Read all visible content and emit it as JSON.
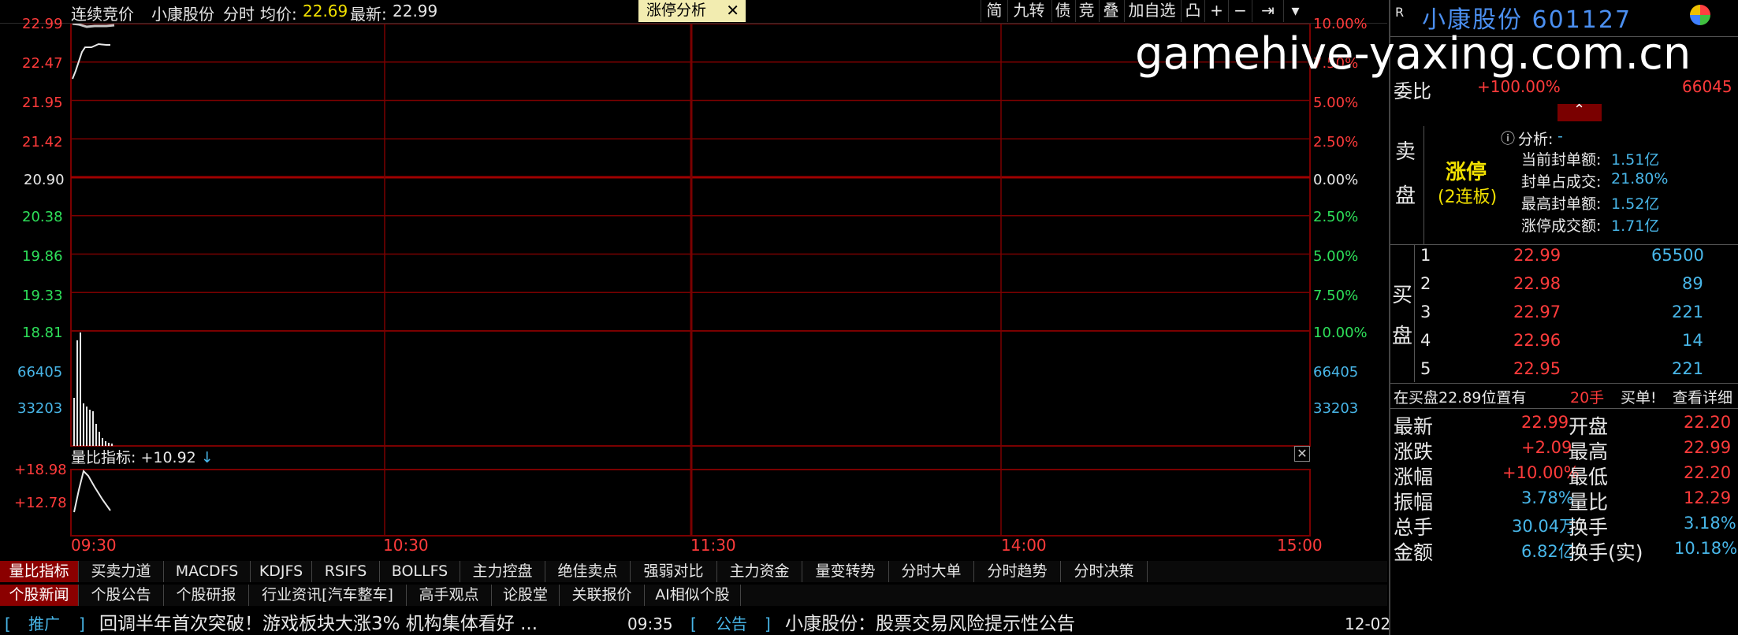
{
  "header": {
    "mode": "连续竞价",
    "stock_name": "小康股份",
    "view": "分时",
    "avg_label": "均价:",
    "avg_value": "22.69",
    "last_label": "最新:",
    "last_value": "22.99",
    "tab_label": "涨停分析",
    "tab_close": "✕",
    "toolbar": [
      "简",
      "九转",
      "债",
      "竞",
      "叠",
      "加自选",
      "凸",
      "+",
      "−",
      "⇥",
      "▾"
    ]
  },
  "price_axis_left": [
    "22.99",
    "22.47",
    "21.95",
    "21.42",
    "20.90",
    "20.38",
    "19.86",
    "19.33",
    "18.81"
  ],
  "pct_axis_right": [
    "10.00%",
    "7.50%",
    "5.00%",
    "2.50%",
    "0.00%",
    "2.50%",
    "5.00%",
    "7.50%",
    "10.00%"
  ],
  "volume_axis": [
    "66405",
    "33203"
  ],
  "indicator": {
    "label": "量比指标:",
    "value": "+10.92",
    "arrow": "↓",
    "axis": [
      "+18.98",
      "+12.78"
    ],
    "close": "✕"
  },
  "time_axis": [
    "09:30",
    "10:30",
    "11:30",
    "14:00",
    "15:00"
  ],
  "indicator_tabs": [
    "量比指标",
    "买卖力道",
    "MACDFS",
    "KDJFS",
    "RSIFS",
    "BOLLFS",
    "主力控盘",
    "绝佳卖点",
    "强弱对比",
    "主力资金",
    "量变转势",
    "分时大单",
    "分时趋势",
    "分时决策"
  ],
  "news_tabs": [
    "个股新闻",
    "个股公告",
    "个股研报",
    "行业资讯[汽车整车]",
    "高手观点",
    "论股堂",
    "关联报价",
    "AI相似个股"
  ],
  "ticker": {
    "tag1_open": "[",
    "tag1": "推广",
    "tag1_close": "]",
    "headline1": "回调半年首次突破！游戏板块大涨3% 机构集体看好 ...",
    "time1": "09:35",
    "tag2_open": "[",
    "tag2": "公告",
    "tag2_close": "]",
    "headline2": "小康股份：股票交易风险提示性公告",
    "date2": "12-02"
  },
  "watermark": "gamehive-yaxing.com.cn",
  "right_panel": {
    "r_label": "R",
    "title": "小康股份 601127",
    "webi_label": "委比",
    "webi_value": "+100.00%",
    "webi_diff": "66045",
    "sell_label": [
      "卖",
      "盘"
    ],
    "limit_up": "涨停",
    "limit_sub": "(2连板)",
    "analysis_label": "分析:",
    "analysis_value": "-",
    "stats": [
      {
        "label": "当前封单额:",
        "value": "1.51亿"
      },
      {
        "label": "封单占成交:",
        "value": "21.80%"
      },
      {
        "label": "最高封单额:",
        "value": "1.52亿"
      },
      {
        "label": "涨停成交额:",
        "value": "1.71亿"
      }
    ],
    "buy_label": [
      "买",
      "盘"
    ],
    "buy_levels": [
      {
        "lv": "1",
        "price": "22.99",
        "vol": "65500"
      },
      {
        "lv": "2",
        "price": "22.98",
        "vol": "89"
      },
      {
        "lv": "3",
        "price": "22.97",
        "vol": "221"
      },
      {
        "lv": "4",
        "price": "22.96",
        "vol": "14"
      },
      {
        "lv": "5",
        "price": "22.95",
        "vol": "221"
      }
    ],
    "queue": {
      "text": "在买盘22.89位置有",
      "qty": "20手",
      "action": "买单!",
      "detail": "查看详细"
    },
    "quote": [
      {
        "l1": "最新",
        "v1": "22.99",
        "l2": "开盘",
        "v2": "22.20"
      },
      {
        "l1": "涨跌",
        "v1": "+2.09",
        "l2": "最高",
        "v2": "22.99"
      },
      {
        "l1": "涨幅",
        "v1": "+10.00%",
        "l2": "最低",
        "v2": "22.20"
      },
      {
        "l1": "振幅",
        "v1": "3.78%",
        "l2": "量比",
        "v2": "12.29"
      },
      {
        "l1": "总手",
        "v1": "30.04万",
        "l2": "换手",
        "v2": "3.18%"
      },
      {
        "l1": "金额",
        "v1": "6.82亿",
        "l2": "换手(实)",
        "v2": "10.18%"
      }
    ]
  },
  "colors": {
    "grid": "#7a0000",
    "up": "#ff3b3b",
    "down": "#2ee05a",
    "accent": "#4b8ff0"
  }
}
